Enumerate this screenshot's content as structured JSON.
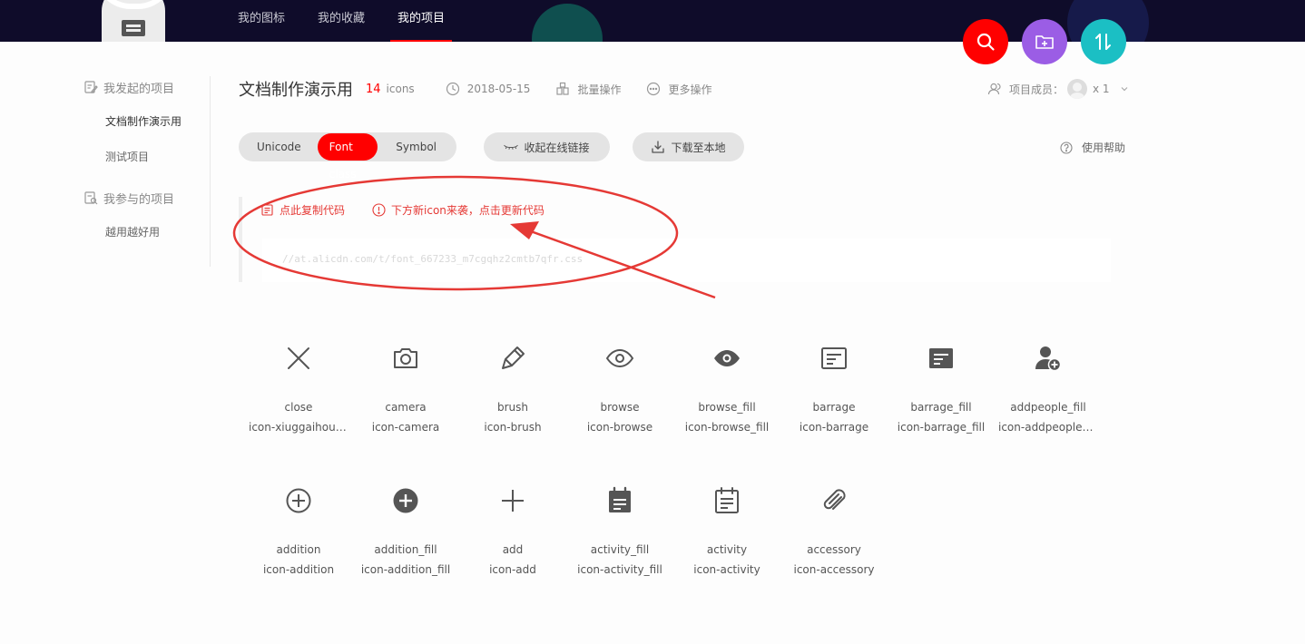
{
  "nav": {
    "items": [
      {
        "label": "我的图标",
        "active": false
      },
      {
        "label": "我的收藏",
        "active": false
      },
      {
        "label": "我的项目",
        "active": true
      }
    ]
  },
  "fabs": [
    {
      "icon": "search-icon",
      "color": "#ff0000"
    },
    {
      "icon": "add-folder-icon",
      "color": "#9b5de5"
    },
    {
      "icon": "sort-icon",
      "color": "#1bbfc4"
    }
  ],
  "sidebar": {
    "initiated_title": "我发起的项目",
    "initiated_items": [
      "文档制作演示用",
      "测试项目"
    ],
    "joined_title": "我参与的项目",
    "joined_items": [
      "越用越好用"
    ]
  },
  "project": {
    "title": "文档制作演示用",
    "count": "14",
    "count_unit": "icons",
    "date": "2018-05-15",
    "batch_label": "批量操作",
    "more_label": "更多操作",
    "members_label": "项目成员：",
    "members_count": "x 1"
  },
  "toolbar": {
    "modes": [
      {
        "label": "Unicode",
        "active": false
      },
      {
        "label": "Font class",
        "active": true
      },
      {
        "label": "Symbol",
        "active": false
      }
    ],
    "collapse_label": "收起在线链接",
    "download_label": "下载至本地",
    "help_label": "使用帮助"
  },
  "codebox": {
    "copy_label": "点此复制代码",
    "update_label": "下方新icon来袭，点击更新代码",
    "url": "//at.alicdn.com/t/font_667233_m7cgqhz2cmtb7qfr.css"
  },
  "colors": {
    "accent": "#ff0000",
    "topbar": "#0f0c2a",
    "annotation": "#e53935"
  },
  "icons": [
    {
      "name": "close",
      "class": "icon-xiuggaihoudechicunxihuan",
      "glyph": "close-icon"
    },
    {
      "name": "camera",
      "class": "icon-camera",
      "glyph": "camera-icon"
    },
    {
      "name": "brush",
      "class": "icon-brush",
      "glyph": "brush-icon"
    },
    {
      "name": "browse",
      "class": "icon-browse",
      "glyph": "browse-icon"
    },
    {
      "name": "browse_fill",
      "class": "icon-browse_fill",
      "glyph": "browse-fill-icon"
    },
    {
      "name": "barrage",
      "class": "icon-barrage",
      "glyph": "barrage-icon"
    },
    {
      "name": "barrage_fill",
      "class": "icon-barrage_fill",
      "glyph": "barrage-fill-icon"
    },
    {
      "name": "addpeople_fill",
      "class": "icon-addpeople_fill",
      "glyph": "addpeople-fill-icon"
    },
    {
      "name": "addition",
      "class": "icon-addition",
      "glyph": "addition-icon"
    },
    {
      "name": "addition_fill",
      "class": "icon-addition_fill",
      "glyph": "addition-fill-icon"
    },
    {
      "name": "add",
      "class": "icon-add",
      "glyph": "add-icon"
    },
    {
      "name": "activity_fill",
      "class": "icon-activity_fill",
      "glyph": "activity-fill-icon"
    },
    {
      "name": "activity",
      "class": "icon-activity",
      "glyph": "activity-icon"
    },
    {
      "name": "accessory",
      "class": "icon-accessory",
      "glyph": "accessory-icon"
    }
  ]
}
